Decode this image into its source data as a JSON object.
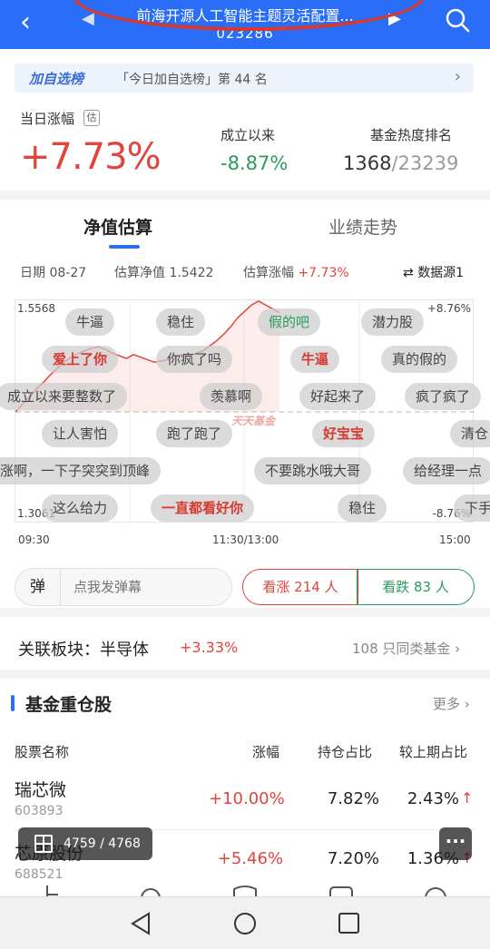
{
  "header": {
    "title": "前海开源人工智能主题灵活配置...",
    "code": "023286"
  },
  "banner": {
    "tag": "加自选榜",
    "text": "「今日加自选榜」第 44 名"
  },
  "stats": {
    "day_change_label": "当日涨幅",
    "est_badge": "估",
    "day_change_value": "+7.73%",
    "since_inception_label": "成立以来",
    "since_inception_value": "-8.87%",
    "heat_rank_label": "基金热度排名",
    "heat_rank": "1368",
    "heat_total": "/23239"
  },
  "tabs": {
    "active": "净值估算",
    "inactive": "业绩走势"
  },
  "estimate_info": {
    "date": "日期 08-27",
    "nav_est_label": "估算净值",
    "nav_est_value": "1.5422",
    "change_est_label": "估算涨幅",
    "change_est_value": "+7.73%",
    "source": "数据源1"
  },
  "chart_data": {
    "type": "line",
    "y_left_top": "1.5568",
    "y_left_bottom": "1.3061",
    "y_right_top": "+8.76%",
    "y_right_bottom": "-8.76%",
    "x_ticks": [
      "09:30",
      "11:30/13:00",
      "15:00"
    ],
    "ylim": [
      -8.76,
      8.76
    ],
    "watermark": "天天基金",
    "series": [
      {
        "values": [
          0.0,
          0.6,
          1.2,
          1.8,
          2.3,
          2.9,
          3.4,
          3.9,
          4.3,
          4.6,
          4.8,
          5.0,
          5.1,
          4.9,
          4.6,
          4.4,
          4.2,
          4.5,
          4.3,
          4.1,
          3.9,
          4.0,
          4.1,
          4.3,
          4.5,
          4.4,
          4.6,
          4.8,
          5.2,
          5.6,
          6.1,
          6.7,
          7.4,
          7.9,
          8.4,
          8.7,
          8.4,
          8.1,
          7.8
        ]
      }
    ]
  },
  "danmaku": [
    {
      "text": "牛逼",
      "style": "gray"
    },
    {
      "text": "稳住",
      "style": "gray"
    },
    {
      "text": "假的吧",
      "style": "green"
    },
    {
      "text": "潜力股",
      "style": "gray"
    },
    {
      "text": "爱上了你",
      "style": "red"
    },
    {
      "text": "你疯了吗",
      "style": "gray"
    },
    {
      "text": "牛逼",
      "style": "red"
    },
    {
      "text": "真的假的",
      "style": "gray"
    },
    {
      "text": "成立以来要整数了",
      "style": "gray"
    },
    {
      "text": "羡慕啊",
      "style": "gray"
    },
    {
      "text": "好起来了",
      "style": "gray"
    },
    {
      "text": "疯了疯了",
      "style": "gray"
    },
    {
      "text": "让人害怕",
      "style": "gray"
    },
    {
      "text": "跑了跑了",
      "style": "gray"
    },
    {
      "text": "好宝宝",
      "style": "red"
    },
    {
      "text": "清仓",
      "style": "gray"
    },
    {
      "text": "涨啊，一下子突突到顶峰",
      "style": "gray"
    },
    {
      "text": "不要跳水哦大哥",
      "style": "gray"
    },
    {
      "text": "给经理一点",
      "style": "gray"
    },
    {
      "text": "这么给力",
      "style": "gray"
    },
    {
      "text": "一直都看好你",
      "style": "red"
    },
    {
      "text": "稳住",
      "style": "gray"
    },
    {
      "text": "下手",
      "style": "gray"
    }
  ],
  "danmaku_input": {
    "icon_label": "弹",
    "placeholder": "点我发弹幕"
  },
  "votes": {
    "up": "看涨 214 人",
    "down": "看跌 83 人"
  },
  "sector": {
    "label": "关联板块：半导体",
    "pct": "+3.33%",
    "more": "108 只同类基金 ›"
  },
  "holdings": {
    "title": "基金重仓股",
    "more": "更多 ›",
    "columns": [
      "股票名称",
      "涨幅",
      "持仓占比",
      "较上期占比"
    ],
    "rows": [
      {
        "name": "瑞芯微",
        "code": "603893",
        "change": "+10.00%",
        "weight": "7.82%",
        "prev": "2.43%"
      },
      {
        "name": "芯原股份",
        "code": "688521",
        "change": "+5.46%",
        "weight": "7.20%",
        "prev": "1.36%"
      }
    ]
  },
  "overlay": {
    "counter": "4759 / 4768"
  }
}
